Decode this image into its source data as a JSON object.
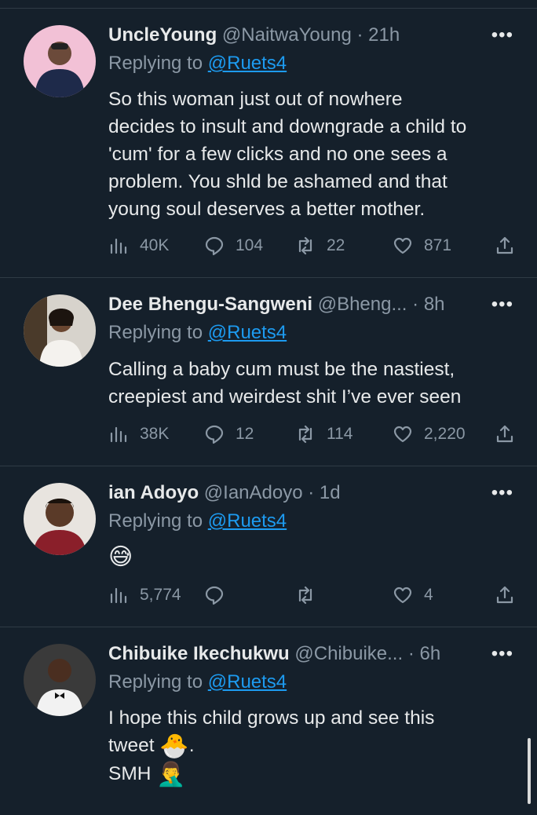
{
  "replying_prefix": "Replying to",
  "more_glyph": "•••",
  "tweets": [
    {
      "name": "UncleYoung",
      "handle": "@NaitwaYoung",
      "dot": "·",
      "time": "21h",
      "replying_to": "@Ruets4",
      "text_lines": [
        "So this woman just out of nowhere",
        "decides to insult and downgrade a child to",
        "'cum' for a few clicks and no one sees a",
        "problem. You shld be ashamed and that",
        "young soul deserves a better mother."
      ],
      "views": "40K",
      "replies": "104",
      "retweets": "22",
      "likes": "871"
    },
    {
      "name": "Dee Bhengu-Sangweni",
      "handle": "@Bheng...",
      "dot": "·",
      "time": "8h",
      "replying_to": "@Ruets4",
      "text_lines": [
        "Calling a baby cum must be the nastiest,",
        "creepiest and weirdest shit I’ve ever seen"
      ],
      "views": "38K",
      "replies": "12",
      "retweets": "114",
      "likes": "2,220"
    },
    {
      "name": "ian Adoyo",
      "handle": "@IanAdoyo",
      "dot": "·",
      "time": "1d",
      "replying_to": "@Ruets4",
      "emoji": "😅",
      "views": "5,774",
      "replies": "",
      "retweets": "",
      "likes": "4"
    },
    {
      "name": "Chibuike Ikechukwu",
      "handle": "@Chibuike...",
      "dot": "·",
      "time": "6h",
      "replying_to": "@Ruets4",
      "text_line1": "I hope this child grows up and see this",
      "text_line2_prefix": "tweet",
      "emoji1": "🐣",
      "text_line2_suffix": ".",
      "text_line3": "SMH",
      "emoji2": "🤦‍♂️"
    }
  ]
}
